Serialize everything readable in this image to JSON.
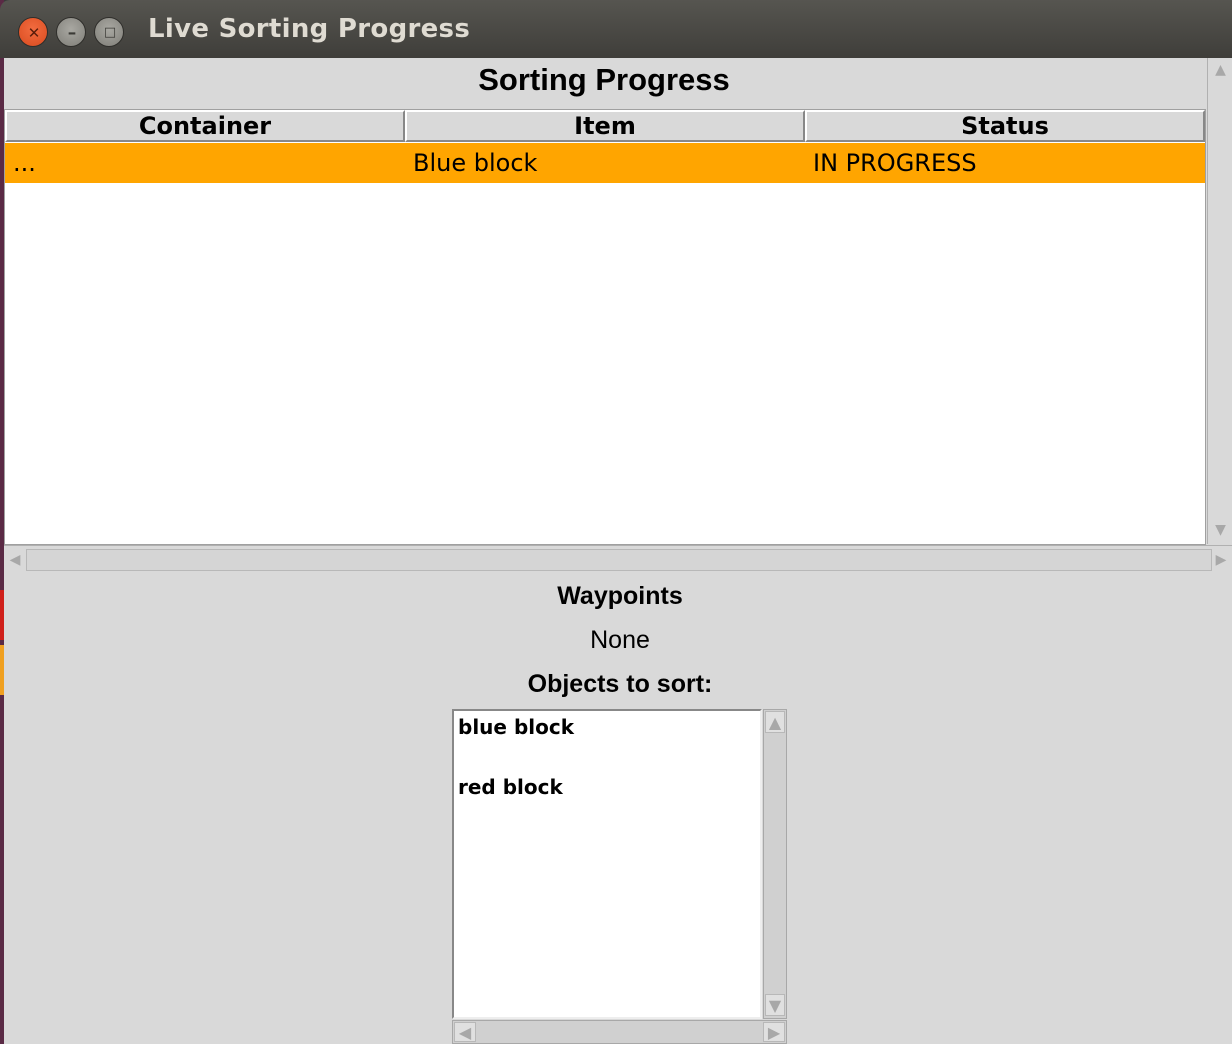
{
  "window": {
    "title": "Live Sorting Progress",
    "close_glyph": "✕",
    "minimize_glyph": "–",
    "maximize_glyph": "□"
  },
  "progress": {
    "heading": "Sorting Progress",
    "columns": [
      "Container",
      "Item",
      "Status"
    ],
    "rows": [
      {
        "container": "...",
        "item": "Blue block",
        "status": "IN PROGRESS",
        "highlight": "#ffa500"
      }
    ]
  },
  "waypoints": {
    "label": "Waypoints",
    "value": "None"
  },
  "objects": {
    "label": "Objects to sort:",
    "items": [
      "blue block",
      "red block"
    ]
  },
  "colors": {
    "selected_row": "#ffa500",
    "window_bg": "#d9d9d9",
    "close_button": "#e05a2a"
  }
}
